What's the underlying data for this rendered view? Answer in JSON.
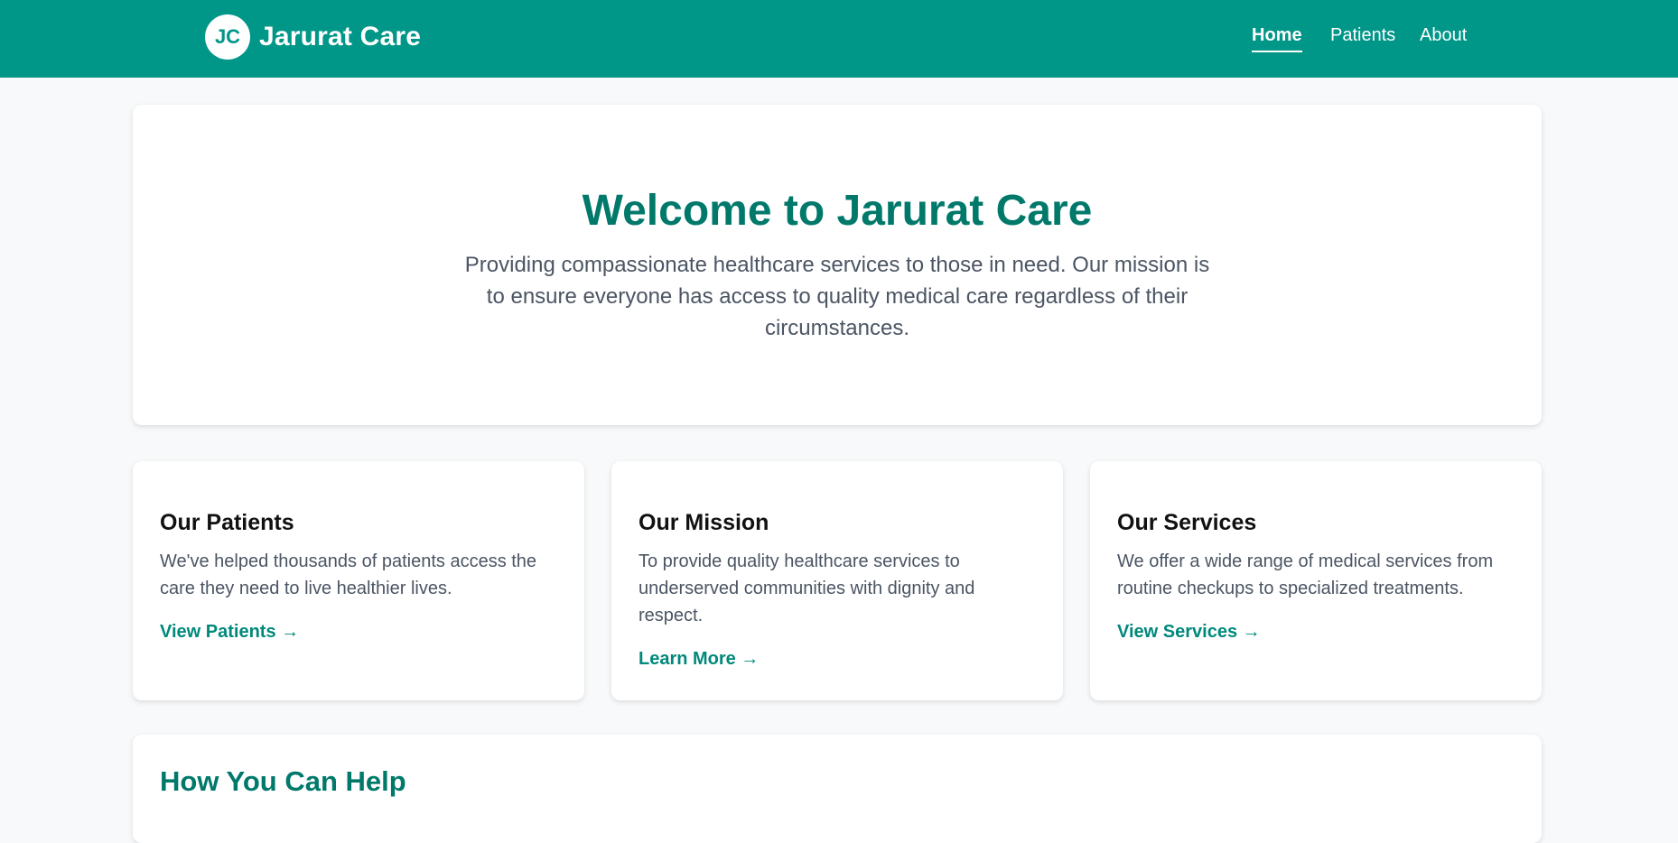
{
  "brand": {
    "logo_initials": "JC",
    "name": "Jarurat Care"
  },
  "nav": {
    "items": [
      {
        "label": "Home",
        "active": true
      },
      {
        "label": "Patients",
        "active": false
      },
      {
        "label": "About",
        "active": false
      }
    ]
  },
  "hero": {
    "title": "Welcome to Jarurat Care",
    "text": "Providing compassionate healthcare services to those in need. Our mission is to ensure everyone has access to quality medical care regardless of their circumstances."
  },
  "cards": [
    {
      "title": "Our Patients",
      "text": "We've helped thousands of patients access the care they need to live healthier lives.",
      "link": "View Patients →"
    },
    {
      "title": "Our Mission",
      "text": "To provide quality healthcare services to underserved communities with dignity and respect.",
      "link": "Learn More →"
    },
    {
      "title": "Our Services",
      "text": "We offer a wide range of medical services from routine checkups to specialized treatments.",
      "link": "View Services →"
    }
  ],
  "help": {
    "title": "How You Can Help"
  },
  "colors": {
    "primary": "#009688",
    "primary_dark": "#00796b",
    "background": "#f8f9fa"
  }
}
